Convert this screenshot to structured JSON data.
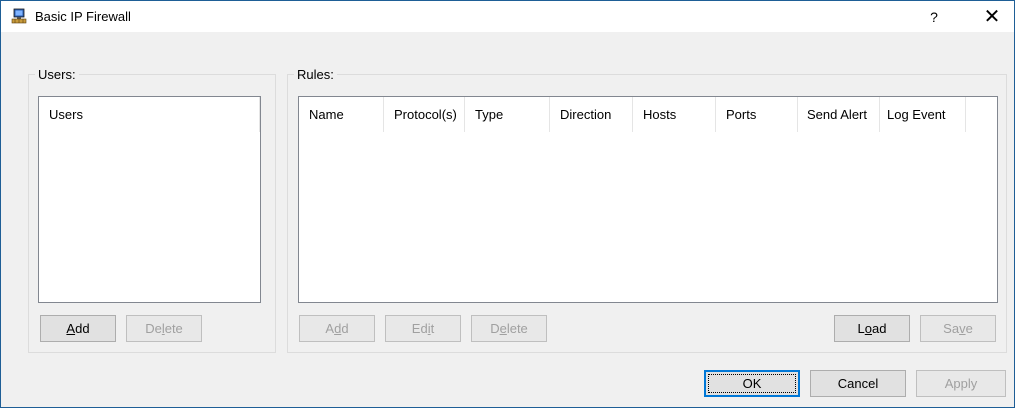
{
  "window": {
    "title": "Basic IP Firewall",
    "help_label": "?",
    "close_label": "✕"
  },
  "users_group": {
    "label": "Users:",
    "list_header": "Users",
    "add_button": {
      "pre": "",
      "mnemonic": "A",
      "post": "dd",
      "enabled": true
    },
    "delete_button": {
      "pre": "De",
      "mnemonic": "l",
      "post": "ete",
      "enabled": false
    }
  },
  "rules_group": {
    "label": "Rules:",
    "columns": [
      "Name",
      "Protocol(s)",
      "Type",
      "Direction",
      "Hosts",
      "Ports",
      "Send Alert",
      "Log Event"
    ],
    "add_button": {
      "pre": "A",
      "mnemonic": "d",
      "post": "d",
      "enabled": false
    },
    "edit_button": {
      "pre": "Ed",
      "mnemonic": "i",
      "post": "t",
      "enabled": false
    },
    "delete_button": {
      "pre": "D",
      "mnemonic": "e",
      "post": "lete",
      "enabled": false
    },
    "load_button": {
      "pre": "L",
      "mnemonic": "o",
      "post": "ad",
      "enabled": true
    },
    "save_button": {
      "pre": "Sa",
      "mnemonic": "v",
      "post": "e",
      "enabled": false
    }
  },
  "footer": {
    "ok_label": "OK",
    "cancel_label": "Cancel",
    "apply_label": "Apply",
    "apply_enabled": false
  },
  "colors": {
    "accent": "#0078d7",
    "window_border": "#1e5e96",
    "disabled_text": "#a0a0a0"
  }
}
